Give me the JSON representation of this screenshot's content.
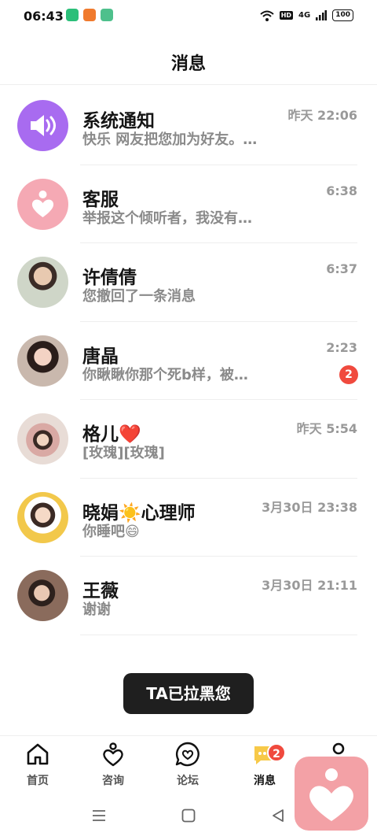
{
  "status_bar": {
    "time": "06:43",
    "network": "4G",
    "hd": "HD",
    "battery": "100",
    "app_icon_colors": [
      "#2bbf79",
      "#f07a2d",
      "#4ec08c"
    ]
  },
  "header": {
    "title": "消息"
  },
  "conversations": [
    {
      "name": "系统通知",
      "preview": "快乐 网友把您加为好友。…",
      "time": "昨天 22:06",
      "avatar": "speaker-icon",
      "avatar_color": "#a86bf0"
    },
    {
      "name": "客服",
      "preview": "举报这个倾听者，我没有…",
      "time": "6:38",
      "avatar": "heart-person-icon",
      "avatar_color": "#f5a9b4"
    },
    {
      "name": "许倩倩",
      "preview": "您撤回了一条消息",
      "time": "6:37",
      "avatar": "user-photo"
    },
    {
      "name": "唐晶",
      "preview": "你瞅瞅你那个死b样，被…",
      "time": "2:23",
      "avatar": "user-photo",
      "unread": "2"
    },
    {
      "name": "格儿❤️",
      "preview": "[玫瑰][玫瑰]",
      "time": "昨天 5:54",
      "avatar": "user-photo"
    },
    {
      "name": "晓娟☀️心理师",
      "preview": "你睡吧😄",
      "time": "3月30日 23:38",
      "avatar": "user-photo"
    },
    {
      "name": "王薇",
      "preview": "谢谢",
      "time": "3月30日 21:11",
      "avatar": "user-photo"
    }
  ],
  "toast": {
    "text": "TA已拉黑您"
  },
  "tab_bar": {
    "tabs": [
      {
        "label": "首页",
        "icon": "home-icon"
      },
      {
        "label": "咨询",
        "icon": "heart-person-icon"
      },
      {
        "label": "论坛",
        "icon": "heart-chat-icon"
      },
      {
        "label": "消息",
        "icon": "message-icon",
        "badge": "2",
        "active": true
      },
      {
        "label": "",
        "icon": "profile-icon"
      }
    ]
  },
  "colors": {
    "accent_purple": "#a86bf0",
    "accent_pink": "#f5a9b4",
    "badge_red": "#f04a3e",
    "message_yellow": "#f7c948"
  }
}
